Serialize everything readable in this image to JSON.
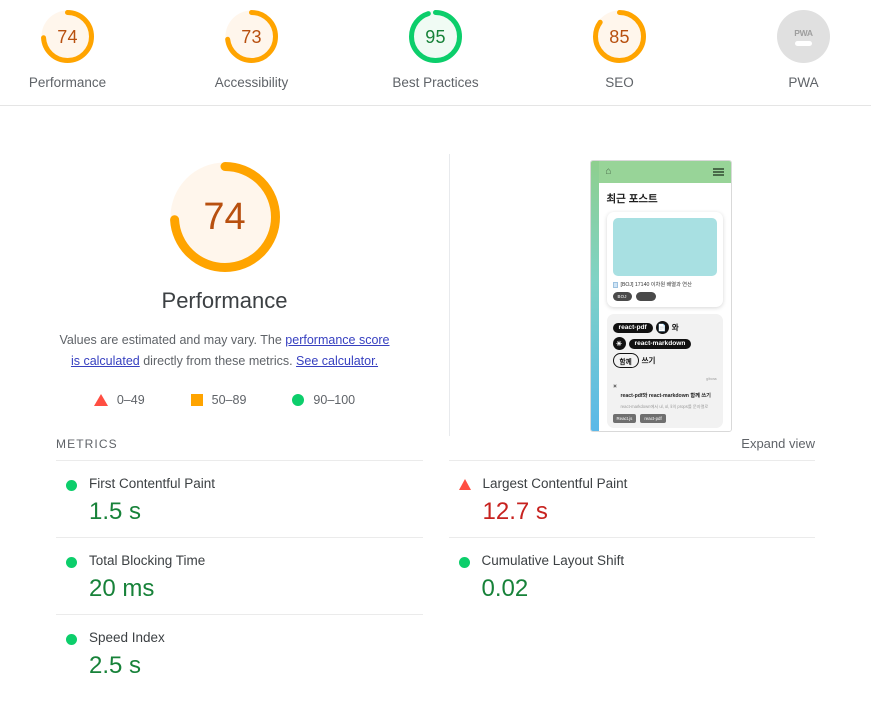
{
  "gauges": [
    {
      "label": "Performance",
      "score": "74",
      "state": "average",
      "pct": 74
    },
    {
      "label": "Accessibility",
      "score": "73",
      "state": "average",
      "pct": 73
    },
    {
      "label": "Best Practices",
      "score": "95",
      "state": "pass",
      "pct": 95
    },
    {
      "label": "SEO",
      "score": "85",
      "state": "average",
      "pct": 85
    },
    {
      "label": "PWA",
      "score": "",
      "state": "null",
      "pct": 0,
      "badge": "PWA"
    }
  ],
  "category": {
    "score": "74",
    "title": "Performance",
    "desc_part1": "Values are estimated and may vary. The ",
    "desc_link1": "performance score is calculated",
    "desc_part2": " directly from these metrics. ",
    "desc_link2": "See calculator.",
    "legend": [
      {
        "range": "0–49",
        "shape": "triangle",
        "color": "#ff4e42"
      },
      {
        "range": "50–89",
        "shape": "square",
        "color": "#ffa400"
      },
      {
        "range": "90–100",
        "shape": "circle",
        "color": "#0cce6b"
      }
    ]
  },
  "thumbnail": {
    "home_icon": "⌂",
    "page_title": "최근 포스트",
    "post1": {
      "title": "[BOJ] 17140 이차원 배열과 연산",
      "chips": [
        "BOJ",
        ""
      ]
    },
    "post2": {
      "hero_line1_pill": "react-pdf",
      "hero_line1_icon": "📄",
      "hero_line1_word": "와",
      "hero_line2_icon": "☀",
      "hero_line2_pill": "react-markdown",
      "hero_line3_pill": "함께",
      "hero_line3_word": "쓰기",
      "meta": "g/bona",
      "sun": "☀",
      "sub_title": "react-pdf와 react-markdown 함께 쓰기",
      "sub_desc": "react-markdown에서 ul, ol, li의 props를 문자열로",
      "tags": [
        "React.js",
        "react-pdf"
      ]
    }
  },
  "metrics": {
    "heading": "METRICS",
    "expand_label": "Expand view",
    "left": [
      {
        "name": "First Contentful Paint",
        "value": "1.5 s",
        "state": "pass"
      },
      {
        "name": "Total Blocking Time",
        "value": "20 ms",
        "state": "pass"
      },
      {
        "name": "Speed Index",
        "value": "2.5 s",
        "state": "pass"
      }
    ],
    "right": [
      {
        "name": "Largest Contentful Paint",
        "value": "12.7 s",
        "state": "fail"
      },
      {
        "name": "Cumulative Layout Shift",
        "value": "0.02",
        "state": "pass"
      }
    ]
  },
  "colors": {
    "pass": "#0cce6b",
    "pass_text": "#178239",
    "average": "#ffa400",
    "average_text": "#b8500f",
    "fail": "#ff4e42",
    "fail_text": "#c7221f",
    "null": "#bdbdbd"
  }
}
